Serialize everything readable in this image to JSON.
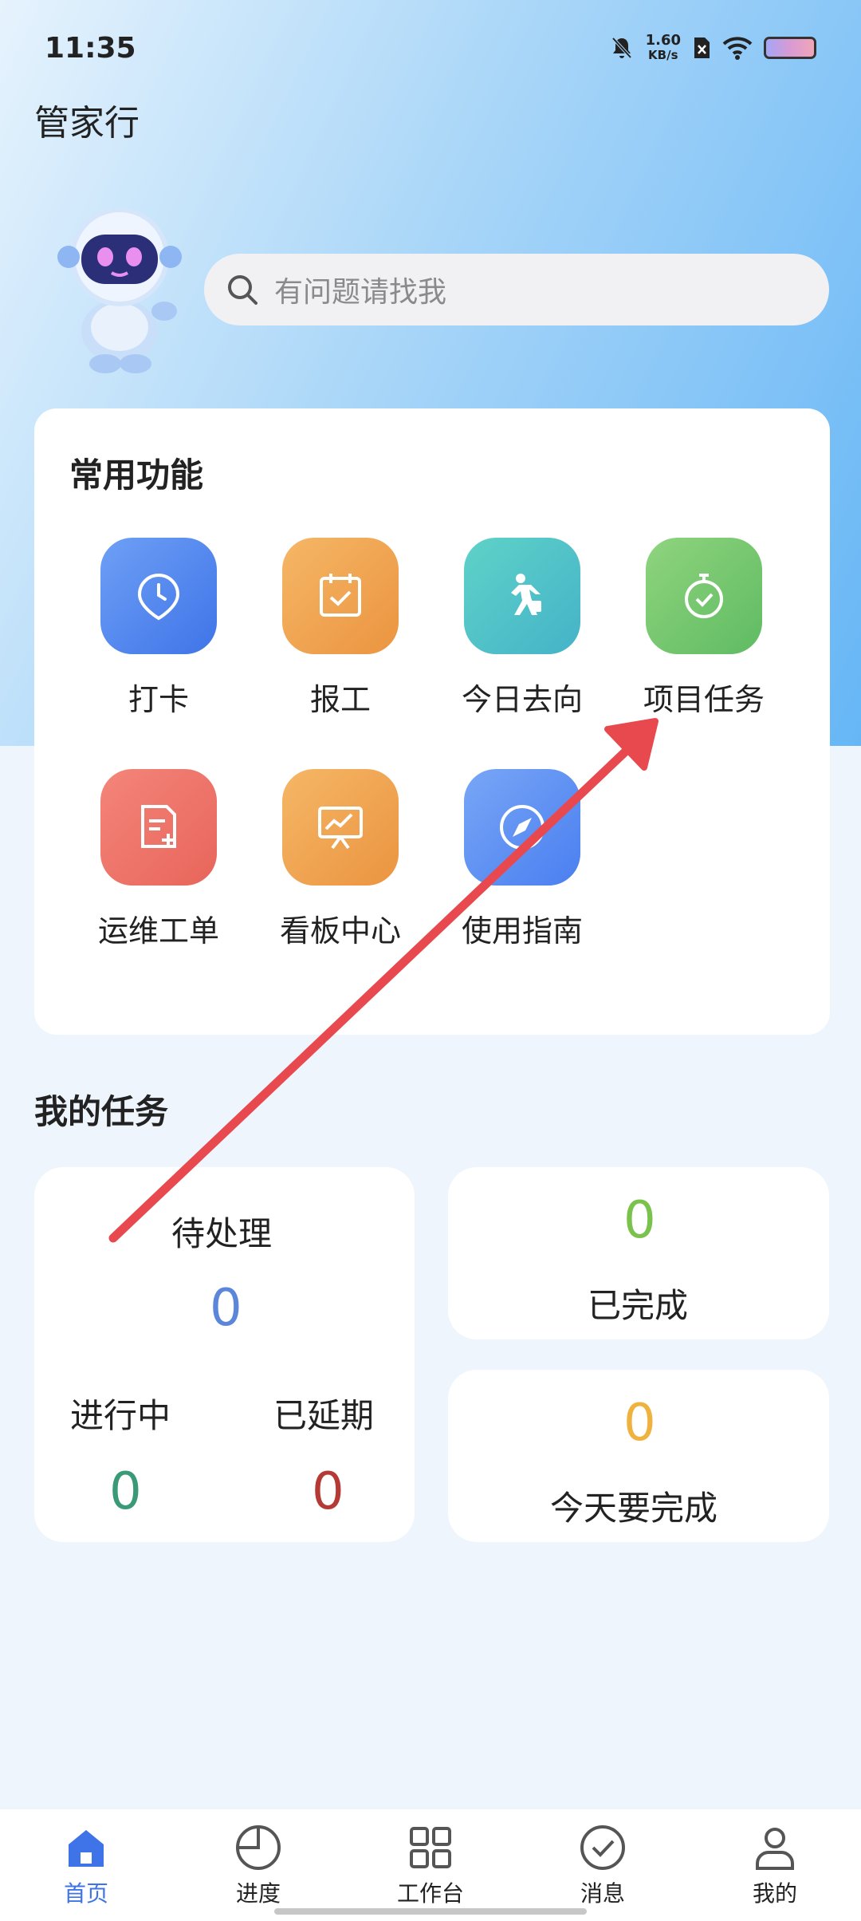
{
  "status_bar": {
    "time": "11:35",
    "net_speed_value": "1.60",
    "net_speed_unit": "KB/s",
    "icons": [
      "bell-off-icon",
      "sim-off-icon",
      "wifi-icon",
      "battery-icon"
    ]
  },
  "app": {
    "title": "管家行"
  },
  "search": {
    "placeholder": "有问题请找我"
  },
  "functions": {
    "title": "常用功能",
    "items": [
      {
        "label": "打卡",
        "icon": "clock-pin-icon",
        "color": "#4f83f1"
      },
      {
        "label": "报工",
        "icon": "calendar-check-icon",
        "color": "#f0a04d"
      },
      {
        "label": "今日去向",
        "icon": "walking-person-icon",
        "color": "#49c1c6"
      },
      {
        "label": "项目任务",
        "icon": "stopwatch-check-icon",
        "color": "#6cc56e"
      },
      {
        "label": "运维工单",
        "icon": "document-add-icon",
        "color": "#ee7467"
      },
      {
        "label": "看板中心",
        "icon": "presentation-chart-icon",
        "color": "#f0a04d"
      },
      {
        "label": "使用指南",
        "icon": "compass-icon",
        "color": "#5b8ff2"
      }
    ]
  },
  "tasks": {
    "title": "我的任务",
    "pending_label": "待处理",
    "pending_value": "0",
    "in_progress_label": "进行中",
    "in_progress_value": "0",
    "delayed_label": "已延期",
    "delayed_value": "0",
    "completed_label": "已完成",
    "completed_value": "0",
    "today_label": "今天要完成",
    "today_value": "0",
    "colors": {
      "pending": "#5b86d9",
      "in_progress": "#3a9a78",
      "delayed": "#b53a35",
      "completed": "#79c24b",
      "today": "#f0b23e"
    }
  },
  "bottom_nav": {
    "items": [
      {
        "label": "首页",
        "icon": "home-icon",
        "active": true
      },
      {
        "label": "进度",
        "icon": "pie-chart-icon",
        "active": false
      },
      {
        "label": "工作台",
        "icon": "grid-icon",
        "active": false
      },
      {
        "label": "消息",
        "icon": "check-circle-icon",
        "active": false
      },
      {
        "label": "我的",
        "icon": "person-icon",
        "active": false
      }
    ]
  }
}
